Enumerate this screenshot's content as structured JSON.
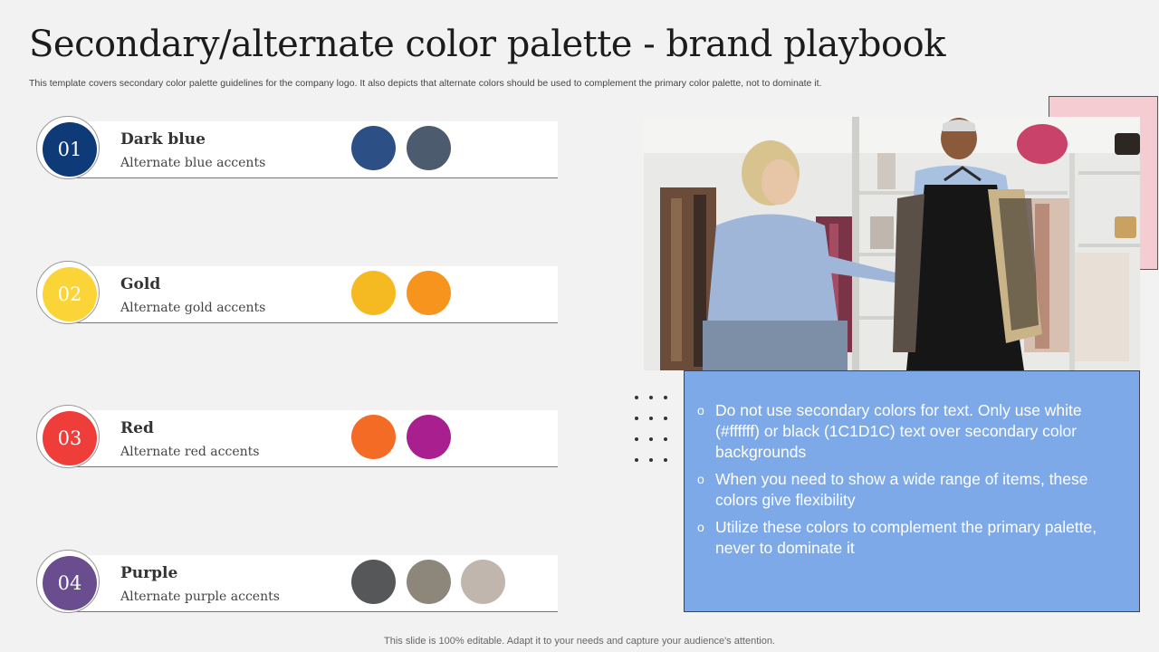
{
  "header": {
    "title": "Secondary/alternate  color  palette - brand playbook",
    "subtitle": "This template covers secondary color palette guidelines for the company logo. It also depicts that alternate colors should be used to complement the primary color palette, not to dominate it."
  },
  "palettes": [
    {
      "number": "01",
      "name": "Dark blue",
      "subtitle": "Alternate blue accents",
      "badge_color": "#0e3a78",
      "swatches": [
        "#2c4f86",
        "#4d5b6e"
      ]
    },
    {
      "number": "02",
      "name": "Gold",
      "subtitle": "Alternate gold accents",
      "badge_color": "#fbd537",
      "swatches": [
        "#f5b922",
        "#f7941d"
      ]
    },
    {
      "number": "03",
      "name": "Red",
      "subtitle": "Alternate red accents",
      "badge_color": "#ef3d3a",
      "swatches": [
        "#f36b24",
        "#a91f8f"
      ]
    },
    {
      "number": "04",
      "name": "Purple",
      "subtitle": "Alternate purple accents",
      "badge_color": "#6a4d8f",
      "swatches": [
        "#555759",
        "#8d877b",
        "#c1b6ae"
      ]
    }
  ],
  "info": {
    "bullets": [
      "Do not use secondary colors for text. Only use white (#ffffff) or black (1C1D1C) text over secondary color backgrounds",
      "When you need to show a wide range of items, these colors give flexibility",
      "Utilize these colors to complement the primary palette, never to dominate it"
    ],
    "bullet_mark": "o",
    "box_color": "#7da9e8"
  },
  "photo": {
    "icon": "boutique-shopping-photo"
  },
  "footer": {
    "text": "This slide is 100% editable. Adapt it to your needs and capture your audience's attention."
  }
}
